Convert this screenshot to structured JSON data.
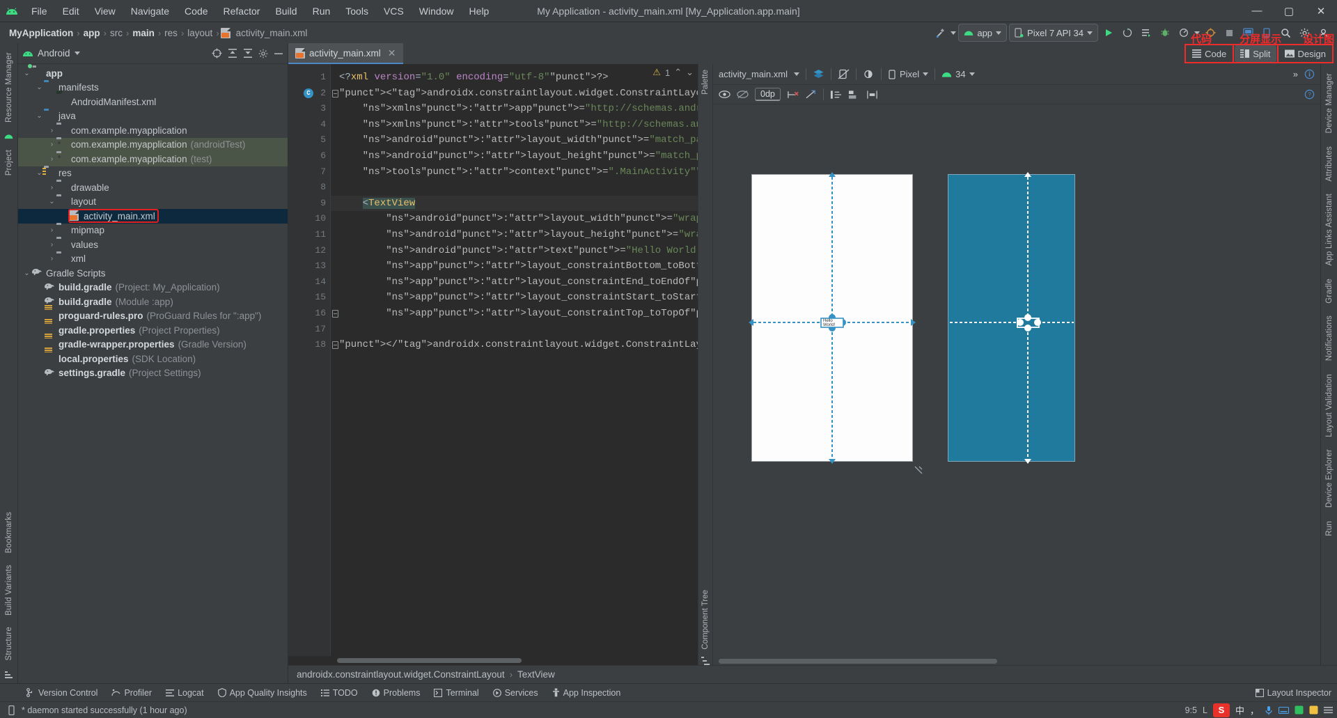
{
  "window": {
    "title": "My Application - activity_main.xml [My_Application.app.main]",
    "minimize": "—",
    "maximize": "▢",
    "close": "✕"
  },
  "menubar": {
    "items": [
      "File",
      "Edit",
      "View",
      "Navigate",
      "Code",
      "Refactor",
      "Build",
      "Run",
      "Tools",
      "VCS",
      "Window",
      "Help"
    ]
  },
  "breadcrumb": {
    "items": [
      "MyApplication",
      "app",
      "src",
      "main",
      "res",
      "layout",
      "activity_main.xml"
    ],
    "separator": "›"
  },
  "toolbar": {
    "module_label": "app",
    "device_label": "Pixel 7 API 34",
    "run_label": "▶",
    "debug_label": "🐞",
    "search_label": "search-icon",
    "settings_label": "gear-icon"
  },
  "project_panel": {
    "title": "Android",
    "tree": [
      {
        "indent": 0,
        "arrow": "⌄",
        "icon": "folder-app",
        "label": "app",
        "bold": true,
        "muted": ""
      },
      {
        "indent": 1,
        "arrow": "⌄",
        "icon": "folder-blue",
        "label": "manifests",
        "bold": false,
        "muted": ""
      },
      {
        "indent": 2,
        "arrow": "",
        "icon": "manifest-file",
        "label": "AndroidManifest.xml",
        "bold": false,
        "muted": ""
      },
      {
        "indent": 1,
        "arrow": "⌄",
        "icon": "folder-blue",
        "label": "java",
        "bold": false,
        "muted": ""
      },
      {
        "indent": 2,
        "arrow": "›",
        "icon": "folder-pkg",
        "label": "com.example.myapplication",
        "bold": false,
        "muted": ""
      },
      {
        "indent": 2,
        "arrow": "›",
        "icon": "folder-pkg",
        "label": "com.example.myapplication",
        "bold": false,
        "muted": "(androidTest)",
        "tint": true
      },
      {
        "indent": 2,
        "arrow": "›",
        "icon": "folder-pkg",
        "label": "com.example.myapplication",
        "bold": false,
        "muted": "(test)",
        "tint": true
      },
      {
        "indent": 1,
        "arrow": "⌄",
        "icon": "folder-res",
        "label": "res",
        "bold": false,
        "muted": ""
      },
      {
        "indent": 2,
        "arrow": "›",
        "icon": "folder-pkg",
        "label": "drawable",
        "bold": false,
        "muted": ""
      },
      {
        "indent": 2,
        "arrow": "⌄",
        "icon": "folder-pkg",
        "label": "layout",
        "bold": false,
        "muted": ""
      },
      {
        "indent": 3,
        "arrow": "",
        "icon": "xml-file",
        "label": "activity_main.xml",
        "bold": false,
        "muted": "",
        "selected": true,
        "highlight": true
      },
      {
        "indent": 2,
        "arrow": "›",
        "icon": "folder-pkg",
        "label": "mipmap",
        "bold": false,
        "muted": ""
      },
      {
        "indent": 2,
        "arrow": "›",
        "icon": "folder-pkg",
        "label": "values",
        "bold": false,
        "muted": ""
      },
      {
        "indent": 2,
        "arrow": "›",
        "icon": "folder-pkg",
        "label": "xml",
        "bold": false,
        "muted": ""
      },
      {
        "indent": 0,
        "arrow": "⌄",
        "icon": "gradle-elephant",
        "label": "Gradle Scripts",
        "bold": false,
        "muted": ""
      },
      {
        "indent": 1,
        "arrow": "",
        "icon": "gradle-elephant",
        "label": "build.gradle",
        "bold": true,
        "muted": "(Project: My_Application)"
      },
      {
        "indent": 1,
        "arrow": "",
        "icon": "gradle-elephant",
        "label": "build.gradle",
        "bold": true,
        "muted": "(Module :app)"
      },
      {
        "indent": 1,
        "arrow": "",
        "icon": "props-file",
        "label": "proguard-rules.pro",
        "bold": true,
        "muted": "(ProGuard Rules for \":app\")"
      },
      {
        "indent": 1,
        "arrow": "",
        "icon": "props-file",
        "label": "gradle.properties",
        "bold": true,
        "muted": "(Project Properties)"
      },
      {
        "indent": 1,
        "arrow": "",
        "icon": "props-file",
        "label": "gradle-wrapper.properties",
        "bold": true,
        "muted": "(Gradle Version)"
      },
      {
        "indent": 1,
        "arrow": "",
        "icon": "props-file",
        "label": "local.properties",
        "bold": true,
        "muted": "(SDK Location)"
      },
      {
        "indent": 1,
        "arrow": "",
        "icon": "gradle-elephant",
        "label": "settings.gradle",
        "bold": true,
        "muted": "(Project Settings)"
      }
    ]
  },
  "left_rail": {
    "items": [
      "Resource Manager",
      "Project",
      "Bookmarks",
      "Build Variants",
      "Structure"
    ]
  },
  "right_rail": {
    "items": [
      "Device Manager",
      "App Links Assistant",
      "Gradle",
      "Notifications",
      "Layout Validation",
      "Device Explorer",
      "Run"
    ]
  },
  "editor": {
    "tab_label": "activity_main.xml",
    "tab_close": "✕",
    "warning_count": "1",
    "mode_buttons": [
      {
        "label": "Code",
        "annotation": "代码",
        "active": false
      },
      {
        "label": "Split",
        "annotation": "分屏显示",
        "active": true
      },
      {
        "label": "Design",
        "annotation": "设计图",
        "active": false
      }
    ],
    "lines": [
      {
        "n": 1,
        "gutter_mark": "",
        "fold": false,
        "text": "<?xml version=\"1.0\" encoding=\"utf-8\"?>"
      },
      {
        "n": 2,
        "gutter_mark": "C",
        "fold": true,
        "text": "<androidx.constraintlayout.widget.ConstraintLayout xmlns:andr"
      },
      {
        "n": 3,
        "gutter_mark": "",
        "fold": false,
        "text": "    xmlns:app=\"http://schemas.android.com/apk/res-auto\""
      },
      {
        "n": 4,
        "gutter_mark": "",
        "fold": false,
        "text": "    xmlns:tools=\"http://schemas.android.com/tools\""
      },
      {
        "n": 5,
        "gutter_mark": "",
        "fold": false,
        "text": "    android:layout_width=\"match_parent\""
      },
      {
        "n": 6,
        "gutter_mark": "",
        "fold": false,
        "text": "    android:layout_height=\"match_parent\""
      },
      {
        "n": 7,
        "gutter_mark": "",
        "fold": false,
        "text": "    tools:context=\".MainActivity\">"
      },
      {
        "n": 8,
        "gutter_mark": "",
        "fold": false,
        "text": ""
      },
      {
        "n": 9,
        "gutter_mark": "",
        "fold": true,
        "text": "    <TextView",
        "current": true
      },
      {
        "n": 10,
        "gutter_mark": "",
        "fold": false,
        "text": "        android:layout_width=\"wrap_content\""
      },
      {
        "n": 11,
        "gutter_mark": "",
        "fold": false,
        "text": "        android:layout_height=\"wrap_content\""
      },
      {
        "n": 12,
        "gutter_mark": "",
        "fold": false,
        "text": "        android:text=\"Hello World!\""
      },
      {
        "n": 13,
        "gutter_mark": "",
        "fold": false,
        "text": "        app:layout_constraintBottom_toBottomOf=\"parent\""
      },
      {
        "n": 14,
        "gutter_mark": "",
        "fold": false,
        "text": "        app:layout_constraintEnd_toEndOf=\"parent\""
      },
      {
        "n": 15,
        "gutter_mark": "",
        "fold": false,
        "text": "        app:layout_constraintStart_toStartOf=\"parent\""
      },
      {
        "n": 16,
        "gutter_mark": "",
        "fold": true,
        "text": "        app:layout_constraintTop_toTopOf=\"parent\" />"
      },
      {
        "n": 17,
        "gutter_mark": "",
        "fold": false,
        "text": ""
      },
      {
        "n": 18,
        "gutter_mark": "",
        "fold": true,
        "text": "</androidx.constraintlayout.widget.ConstraintLayout>"
      }
    ],
    "bottom_breadcrumb": [
      "androidx.constraintlayout.widget.ConstraintLayout",
      "TextView"
    ],
    "bottom_breadcrumb_sep": "›"
  },
  "palette_rail": {
    "label": "Palette"
  },
  "component_tree_rail": {
    "label": "Component Tree"
  },
  "design": {
    "file_label": "activity_main.xml",
    "device_label": "Pixel",
    "api_label": "34",
    "dp_value": "0dp",
    "help_icon": "help-icon",
    "info_icon": "info-icon",
    "overflow": "»",
    "preview_text": "Hello World!"
  },
  "bottom_tools": {
    "items": [
      {
        "label": "Version Control",
        "icon": "branch-icon"
      },
      {
        "label": "Profiler",
        "icon": "profiler-icon"
      },
      {
        "label": "Logcat",
        "icon": "logcat-icon"
      },
      {
        "label": "App Quality Insights",
        "icon": "shield-icon"
      },
      {
        "label": "TODO",
        "icon": "list-icon"
      },
      {
        "label": "Problems",
        "icon": "warning-circle-icon"
      },
      {
        "label": "Terminal",
        "icon": "terminal-icon"
      },
      {
        "label": "Services",
        "icon": "services-icon"
      },
      {
        "label": "App Inspection",
        "icon": "inspection-icon"
      }
    ],
    "right_label": "Layout Inspector"
  },
  "statusbar": {
    "message": "* daemon started successfully (1 hour ago)",
    "caret_position": "9:5",
    "encoding_hint": "L",
    "ime": {
      "brand": "S",
      "lang": "中",
      "punct": "，",
      "mic": "mic-icon",
      "keyboard": "keyboard-icon",
      "tray": "tray-icon",
      "menu": "menu-icon"
    }
  }
}
